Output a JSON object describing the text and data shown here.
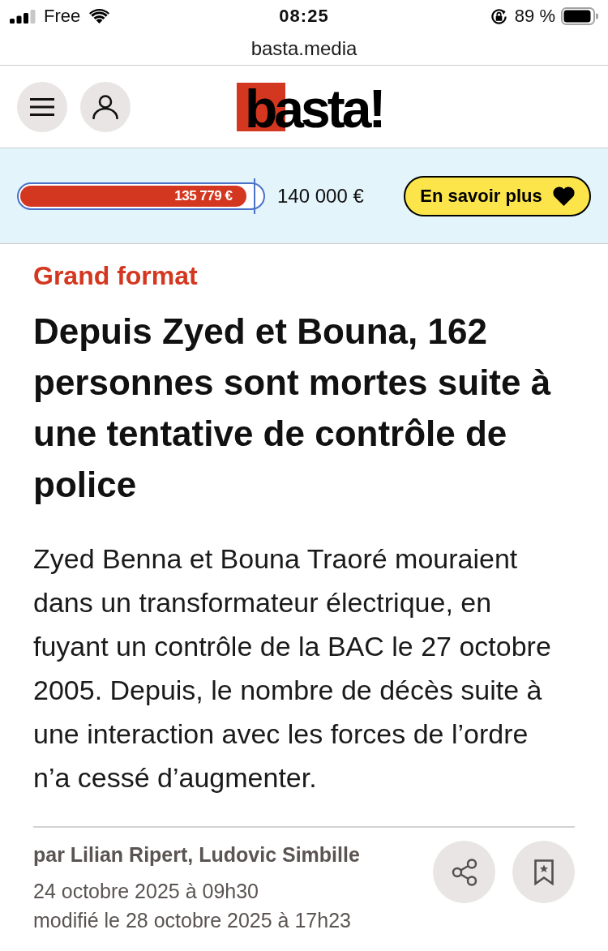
{
  "status_bar": {
    "carrier": "Free",
    "time": "08:25",
    "battery": "89 %"
  },
  "address_bar": {
    "url": "basta.media"
  },
  "header": {
    "logo": "basta!"
  },
  "fundraising": {
    "raised": "135 779 €",
    "level": 0.97,
    "goal": "140 000 €",
    "button": "En savoir plus"
  },
  "article": {
    "category": "Grand format",
    "title": "Depuis Zyed et Bouna, 162 personnes sont mortes suite à une tentative de contrôle de police",
    "lead": "Zyed Benna et Bouna Traoré mouraient dans un transformateur électrique, en fuyant un contrôle de la BAC le 27 octobre 2005. Depuis, le nombre de décès suite à une interaction avec les forces de l’ordre n’a cessé d’augmenter.",
    "byline": "par Lilian Ripert, Ludovic Simbille",
    "published": "24 octobre 2025 à 09h30",
    "modified": "modifié le 28 octobre 2025 à 17h23"
  }
}
